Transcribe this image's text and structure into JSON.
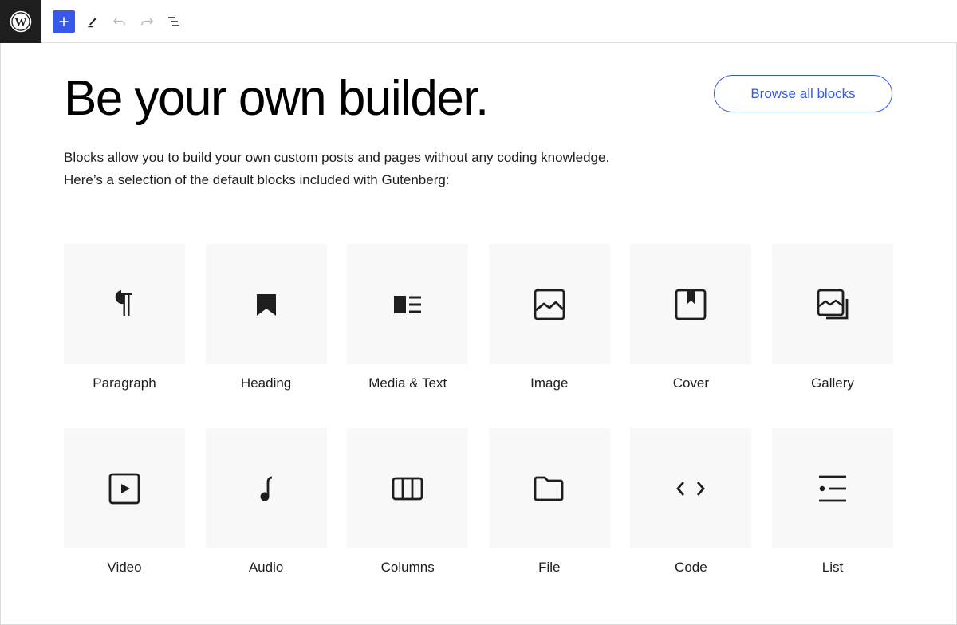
{
  "toolbar": {
    "logo": "wordpress-logo",
    "buttons": [
      {
        "name": "add-block",
        "icon": "plus-icon",
        "label": "+"
      },
      {
        "name": "tools",
        "icon": "pencil-icon"
      },
      {
        "name": "undo",
        "icon": "undo-icon"
      },
      {
        "name": "redo",
        "icon": "redo-icon"
      },
      {
        "name": "document-overview",
        "icon": "list-view-icon"
      }
    ],
    "accent": "#3858e9"
  },
  "hero": {
    "title": "Be your own builder.",
    "browse_button": "Browse all blocks",
    "description_line1": "Blocks allow you to build your own custom posts and pages without any coding knowledge.",
    "description_line2": "Here’s a selection of the default blocks included with Gutenberg:"
  },
  "blocks": [
    {
      "label": "Paragraph",
      "icon": "paragraph-icon"
    },
    {
      "label": "Heading",
      "icon": "bookmark-icon"
    },
    {
      "label": "Media & Text",
      "icon": "media-text-icon"
    },
    {
      "label": "Image",
      "icon": "image-icon"
    },
    {
      "label": "Cover",
      "icon": "cover-icon"
    },
    {
      "label": "Gallery",
      "icon": "gallery-icon"
    },
    {
      "label": "Video",
      "icon": "video-icon"
    },
    {
      "label": "Audio",
      "icon": "audio-icon"
    },
    {
      "label": "Columns",
      "icon": "columns-icon"
    },
    {
      "label": "File",
      "icon": "file-icon"
    },
    {
      "label": "Code",
      "icon": "code-icon"
    },
    {
      "label": "List",
      "icon": "list-icon"
    }
  ]
}
